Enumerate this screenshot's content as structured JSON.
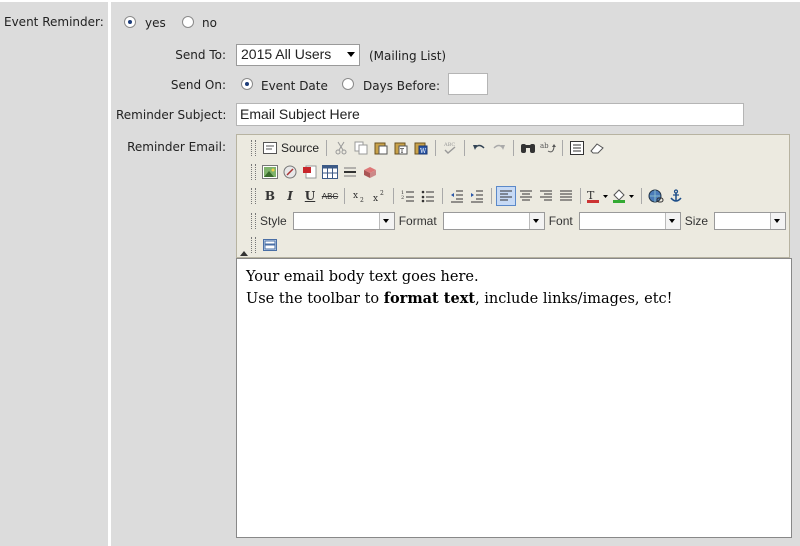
{
  "event_reminder": {
    "label": "Event Reminder:",
    "options": [
      {
        "label": "yes",
        "selected": true
      },
      {
        "label": "no",
        "selected": false
      }
    ]
  },
  "send_to": {
    "label": "Send To:",
    "selected": "2015 All Users",
    "note": "(Mailing List)"
  },
  "send_on": {
    "label": "Send On:",
    "option_event_date": "Event Date",
    "option_days_before": "Days Before:",
    "event_date_selected": true,
    "days_before_value": ""
  },
  "reminder_subject": {
    "label": "Reminder Subject:",
    "value": "Email Subject Here"
  },
  "reminder_email": {
    "label": "Reminder Email:"
  },
  "toolbar": {
    "source_label": "Source",
    "bold": "B",
    "italic": "I",
    "underline": "U",
    "strike": "ABC",
    "style_label": "Style",
    "format_label": "Format",
    "font_label": "Font",
    "size_label": "Size"
  },
  "email_body": {
    "line1": "Your email body text goes here.",
    "line2_pre": "Use the toolbar to ",
    "line2_bold": "format text",
    "line2_post": ", include links/images, etc!"
  }
}
